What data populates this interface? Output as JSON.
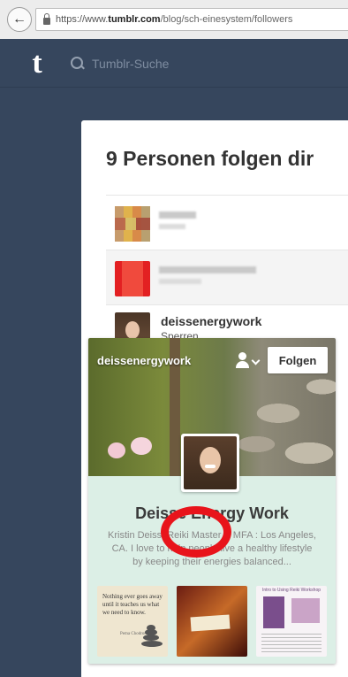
{
  "browser": {
    "url_prefix": "https://www.",
    "url_domain": "tumblr.com",
    "url_path": "/blog/sch-einesystem/followers"
  },
  "topbar": {
    "logo": "t",
    "search_placeholder": "Tumblr-Suche"
  },
  "main": {
    "title": "9 Personen folgen dir"
  },
  "followers": [
    {
      "name": "deissenergywork",
      "action": "Sperren"
    }
  ],
  "card": {
    "blog_name": "deissenergywork",
    "follow_label": "Folgen",
    "title": "Deisse Energy Work",
    "description": "Kristin Deiss, Reiki Master & MFA : Los Angeles, CA. I love to help people live a healthy lifestyle by keeping their energies balanced...",
    "thumb1_quote": "Nothing ever goes away until it teaches us what we need to know.",
    "thumb1_author": "Pema Chodron",
    "thumb3_title": "Intro to Using Reiki Workshop"
  },
  "annotation": {
    "color": "#e8141b"
  },
  "colors": {
    "dashboard_bg": "#36465d",
    "card_bg": "#dcefe6"
  }
}
